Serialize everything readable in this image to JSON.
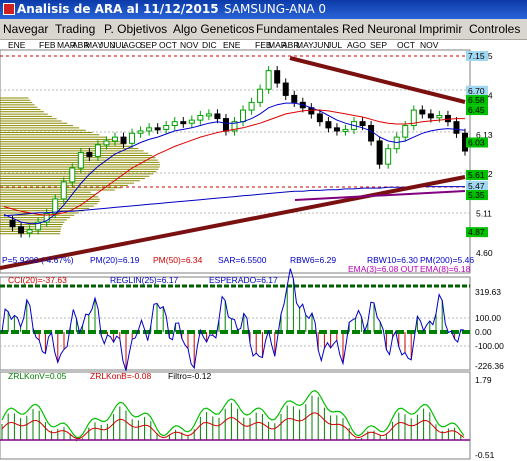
{
  "window": {
    "title": "Analisis de ARA al 11/12/2015",
    "symbol_label": "SAMSUNG-ANA 0"
  },
  "menu": [
    "Navegar",
    "Trading",
    "P. Objetivos",
    "Algo Geneticos",
    "Fundamentales",
    "Red Neuronal",
    "Imprimir",
    "Controles"
  ],
  "months_row": [
    "ENE",
    "FEB",
    "MAR",
    "ABR",
    "MAY",
    "JUN",
    "JUL",
    "AGO",
    "SEP",
    "OCT",
    "NOV",
    "DIC",
    "ENE",
    "FEB",
    "MAR",
    "ABR",
    "MAY",
    "JUN",
    "JUL",
    "AGO",
    "SEP",
    "OCT",
    "NOV"
  ],
  "colors": {
    "price_up": "#00a000",
    "price_down": "#000000",
    "pm20": "#0000d0",
    "pm50": "#e00000",
    "pm200": "#0000c0",
    "trendline": "#7a1010",
    "volume_profile": "#8a8a00",
    "oscillator": "#0000c8",
    "histogram_pos": "#008000",
    "histogram_neg": "#d00000",
    "zrl_line": "#00c000"
  },
  "price_panel": {
    "axis_labels": [
      "7.15",
      "6.64",
      "6.13",
      "5.62",
      "5.11",
      "4.60"
    ],
    "boxed_levels": [
      {
        "text": "7.15",
        "bg": "#9fd8f0"
      },
      {
        "text": "6.70",
        "bg": "#9fd8f0"
      },
      {
        "text": "6.58",
        "bg": "#00c000"
      },
      {
        "text": "6.45",
        "bg": "#00c000"
      },
      {
        "text": "6.03",
        "bg": "#00c000"
      },
      {
        "text": "5.61",
        "bg": "#00c000"
      },
      {
        "text": "5.47",
        "bg": "#9fd8f0"
      },
      {
        "text": "5.35",
        "bg": "#00c000"
      },
      {
        "text": "4.87",
        "bg": "#00c000"
      }
    ],
    "stats_row1": {
      "p": "P=5.9200 (-4.67%)",
      "pm20": "PM(20)=6.19",
      "pm50": "PM(50)=6.34",
      "sar": "SAR=6.5500",
      "rbw6": "RBW6=6.29",
      "rbw10": "RBW10=6.30",
      "pm200": "PM(200)=5.46"
    },
    "stats_row2": {
      "ema3": "EMA(3)=6.08 OUT",
      "ema8": "EMA(8)=6.18"
    }
  },
  "cci_panel": {
    "labels": {
      "cci": "CCI(20)=-37.63",
      "reglin": "REGLIN(25)=6.17",
      "esperado": "ESPERADO=6.17"
    },
    "axis_labels": [
      "319.63",
      "100.00",
      "0.00",
      "-100.00",
      "-226.36"
    ]
  },
  "zrl_panel": {
    "labels": {
      "zrlkonv": "ZRLKonV=0.05",
      "zrlkonb": "ZRLKonB=-0.08",
      "filtro": "Filtro=-0.12"
    },
    "axis_labels": [
      "1.79",
      "-0.51"
    ]
  },
  "chart_data": {
    "type": "line",
    "title": "Analisis de ARA al 11/12/2015",
    "series": [
      {
        "name": "P",
        "values": [
          5.02,
          4.94,
          4.86,
          4.9,
          5.0,
          5.11,
          5.3,
          5.52,
          5.7,
          5.9,
          5.85,
          6.0,
          6.05,
          6.1,
          6.02,
          6.15,
          6.18,
          6.22,
          6.2,
          6.25,
          6.3,
          6.28,
          6.32,
          6.38,
          6.4,
          6.34,
          6.18,
          6.3,
          6.45,
          6.55,
          6.72,
          6.96,
          6.8,
          6.64,
          6.55,
          6.48,
          6.4,
          6.3,
          6.22,
          6.18,
          6.2,
          6.3,
          6.25,
          6.05,
          5.75,
          5.95,
          6.1,
          6.25,
          6.45,
          6.4,
          6.35,
          6.38,
          6.3,
          6.15,
          5.92
        ]
      },
      {
        "name": "PM(20)",
        "values": [
          5.1,
          5.05,
          5.0,
          4.98,
          4.98,
          5.02,
          5.1,
          5.22,
          5.36,
          5.5,
          5.62,
          5.72,
          5.8,
          5.88,
          5.93,
          5.98,
          6.03,
          6.07,
          6.1,
          6.14,
          6.18,
          6.2,
          6.22,
          6.25,
          6.28,
          6.3,
          6.28,
          6.28,
          6.3,
          6.34,
          6.4,
          6.48,
          6.52,
          6.54,
          6.54,
          6.52,
          6.48,
          6.44,
          6.38,
          6.32,
          6.28,
          6.25,
          6.22,
          6.18,
          6.1,
          6.05,
          6.03,
          6.05,
          6.1,
          6.15,
          6.18,
          6.2,
          6.21,
          6.2,
          6.19
        ]
      },
      {
        "name": "PM(50)",
        "values": [
          5.2,
          5.17,
          5.14,
          5.12,
          5.1,
          5.09,
          5.1,
          5.12,
          5.16,
          5.22,
          5.3,
          5.38,
          5.46,
          5.54,
          5.62,
          5.7,
          5.76,
          5.82,
          5.88,
          5.93,
          5.98,
          6.02,
          6.06,
          6.1,
          6.13,
          6.16,
          6.18,
          6.2,
          6.22,
          6.25,
          6.28,
          6.32,
          6.36,
          6.4,
          6.42,
          6.44,
          6.45,
          6.45,
          6.44,
          6.42,
          6.4,
          6.38,
          6.36,
          6.33,
          6.3,
          6.28,
          6.27,
          6.27,
          6.28,
          6.3,
          6.31,
          6.32,
          6.33,
          6.34,
          6.34
        ]
      },
      {
        "name": "PM(200)",
        "values": [
          5.08,
          5.09,
          5.1,
          5.11,
          5.12,
          5.12,
          5.13,
          5.14,
          5.14,
          5.15,
          5.16,
          5.17,
          5.18,
          5.19,
          5.2,
          5.21,
          5.22,
          5.23,
          5.24,
          5.25,
          5.26,
          5.27,
          5.28,
          5.29,
          5.3,
          5.31,
          5.32,
          5.33,
          5.34,
          5.35,
          5.36,
          5.37,
          5.38,
          5.39,
          5.4,
          5.4,
          5.41,
          5.41,
          5.42,
          5.42,
          5.43,
          5.43,
          5.44,
          5.44,
          5.44,
          5.45,
          5.45,
          5.45,
          5.45,
          5.46,
          5.46,
          5.46,
          5.46,
          5.46,
          5.46
        ]
      }
    ],
    "ylim": [
      4.6,
      7.15
    ]
  }
}
